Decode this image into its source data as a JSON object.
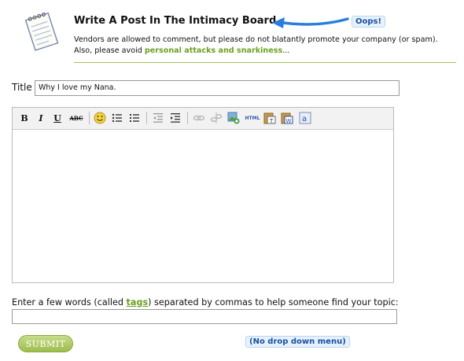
{
  "header": {
    "title": "Write A Post In The Intimacy Board",
    "annotation": "Oops!",
    "description_prefix": "Vendors are allowed to comment, but please do not blatantly promote your company (or spam). Also, please avoid ",
    "description_link": "personal attacks and snarkiness",
    "description_suffix": "..."
  },
  "form": {
    "title_label": "Title",
    "title_value": "Why I love my Nana.",
    "toolbar": {
      "bold": "B",
      "italic": "I",
      "underline": "U",
      "strikethrough": "ABC",
      "html": "HTML",
      "icons": [
        "bold-icon",
        "italic-icon",
        "underline-icon",
        "strikethrough-icon",
        "smiley-icon",
        "bullet-list-icon",
        "numbered-list-icon",
        "outdent-icon",
        "indent-icon",
        "link-icon",
        "unlink-icon",
        "image-icon",
        "html-icon",
        "paste-text-icon",
        "paste-word-icon",
        "find-replace-icon"
      ]
    },
    "tags_label_prefix": "Enter a few words (called ",
    "tags_link": "tags",
    "tags_label_suffix": ") separated by commas to help someone find your topic:",
    "tags_value": "",
    "submit_label": "SUBMIT",
    "annotation_bottom": "(No drop down menu)"
  },
  "colors": {
    "accent_green": "#6aa020",
    "divider_green": "#a3c35b",
    "annotation_blue": "#1b4fa0",
    "arrow_blue": "#2a7fdc"
  }
}
